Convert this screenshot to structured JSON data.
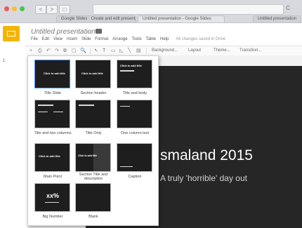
{
  "browser": {
    "url": "",
    "nav_back": "<",
    "nav_forward": ">",
    "nav_sidebar": "□",
    "reload": "C",
    "tabs": [
      {
        "label": "Google Slides · Create and edit presentations online, for free"
      },
      {
        "label": "Untitled presentation - Google Slides"
      },
      {
        "label": "Untitled presentation"
      }
    ]
  },
  "app": {
    "doc_title": "Untitled presentation",
    "star": "☆",
    "menu": [
      "File",
      "Edit",
      "View",
      "Insert",
      "Slide",
      "Format",
      "Arrange",
      "Tools",
      "Table",
      "Help"
    ],
    "save_status": "All changes saved in Drive",
    "toolbar": {
      "icons": [
        "+",
        "⎙",
        "↶",
        "↷",
        "⧉",
        "▢",
        "🔍",
        "↖",
        "T",
        "▭",
        "◺",
        "╲",
        "▤"
      ],
      "background": "Background...",
      "layout": "Layout",
      "theme": "Theme...",
      "transition": "Transition..."
    },
    "slide_number": "1"
  },
  "slide": {
    "title": "smaland 2015",
    "subtitle": "A truly 'horrible' day out"
  },
  "layouts": [
    {
      "label": "Title Slide",
      "thumb_text": "Click to add title"
    },
    {
      "label": "Section header",
      "thumb_text": "Click to add title"
    },
    {
      "label": "Title and body",
      "thumb_text": "Click to add title"
    },
    {
      "label": "Title and two columns",
      "thumb_text": ""
    },
    {
      "label": "Title Only",
      "thumb_text": ""
    },
    {
      "label": "One column text",
      "thumb_text": ""
    },
    {
      "label": "Main Point",
      "thumb_text": "Click to add title"
    },
    {
      "label": "Section Title and description",
      "thumb_text": "Click to add title"
    },
    {
      "label": "Caption",
      "thumb_text": ""
    },
    {
      "label": "Big Number",
      "thumb_text": "xx%"
    },
    {
      "label": "Blank",
      "thumb_text": ""
    }
  ],
  "colors": {
    "slide_bg": "#262626",
    "accent": "#f4b400",
    "selection": "#4d90fe"
  }
}
